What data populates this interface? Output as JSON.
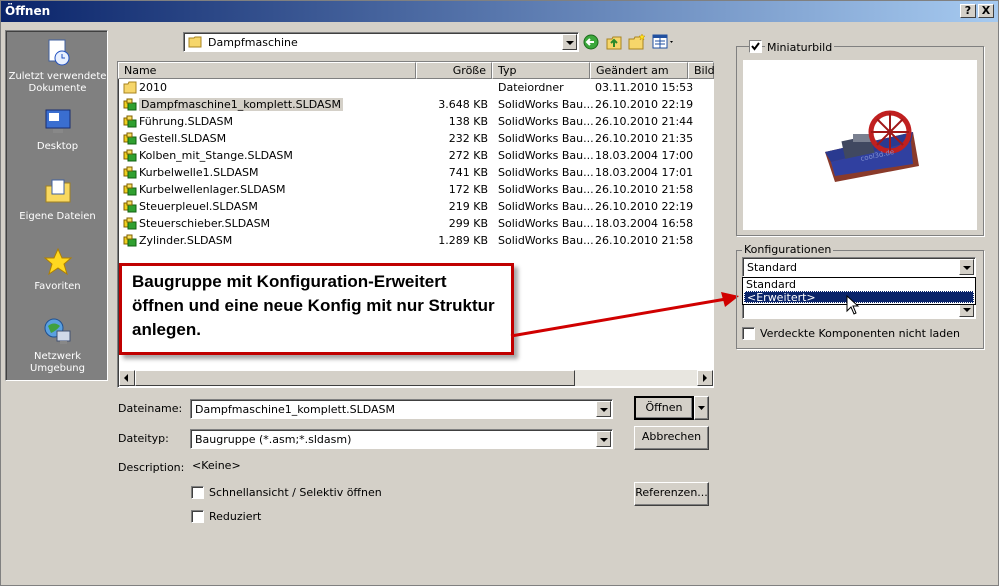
{
  "window": {
    "title": "Öffnen",
    "help_label": "?",
    "close_label": "X"
  },
  "places": [
    {
      "label": "Zuletzt verwendete Dokumente",
      "icon": "recent-docs-icon"
    },
    {
      "label": "Desktop",
      "icon": "desktop-icon"
    },
    {
      "label": "Eigene Dateien",
      "icon": "my-documents-icon"
    },
    {
      "label": "Favoriten",
      "icon": "favorites-star-icon"
    },
    {
      "label": "Netzwerk Umgebung",
      "icon": "network-icon"
    }
  ],
  "location": {
    "value": "Dampfmaschine"
  },
  "columns": {
    "name": "Name",
    "size": "Größe",
    "type": "Typ",
    "modified": "Geändert am",
    "preview": "Bild"
  },
  "files": [
    {
      "name": "2010",
      "size": "",
      "type": "Dateiordner",
      "modified": "03.11.2010 15:53",
      "kind": "folder"
    },
    {
      "name": "Dampfmaschine1_komplett.SLDASM",
      "size": "3.648 KB",
      "type": "SolidWorks Bau...",
      "modified": "26.10.2010 22:19",
      "kind": "assembly"
    },
    {
      "name": "Führung.SLDASM",
      "size": "138 KB",
      "type": "SolidWorks Bau...",
      "modified": "26.10.2010 21:44",
      "kind": "assembly"
    },
    {
      "name": "Gestell.SLDASM",
      "size": "232 KB",
      "type": "SolidWorks Bau...",
      "modified": "26.10.2010 21:35",
      "kind": "assembly"
    },
    {
      "name": "Kolben_mit_Stange.SLDASM",
      "size": "272 KB",
      "type": "SolidWorks Bau...",
      "modified": "18.03.2004 17:00",
      "kind": "assembly"
    },
    {
      "name": "Kurbelwelle1.SLDASM",
      "size": "741 KB",
      "type": "SolidWorks Bau...",
      "modified": "18.03.2004 17:01",
      "kind": "assembly"
    },
    {
      "name": "Kurbelwellenlager.SLDASM",
      "size": "172 KB",
      "type": "SolidWorks Bau...",
      "modified": "26.10.2010 21:58",
      "kind": "assembly"
    },
    {
      "name": "Steuerpleuel.SLDASM",
      "size": "219 KB",
      "type": "SolidWorks Bau...",
      "modified": "26.10.2010 22:19",
      "kind": "assembly"
    },
    {
      "name": "Steuerschieber.SLDASM",
      "size": "299 KB",
      "type": "SolidWorks Bau...",
      "modified": "18.03.2004 16:58",
      "kind": "assembly"
    },
    {
      "name": "Zylinder.SLDASM",
      "size": "1.289 KB",
      "type": "SolidWorks Bau...",
      "modified": "26.10.2010 21:58",
      "kind": "assembly"
    }
  ],
  "selected_file_index": 1,
  "filename": {
    "label": "Dateiname:",
    "value": "Dampfmaschine1_komplett.SLDASM"
  },
  "filetype": {
    "label": "Dateityp:",
    "value": "Baugruppe (*.asm;*.sldasm)"
  },
  "description": {
    "label": "Description:",
    "value": "<Keine>"
  },
  "options": {
    "quickview": {
      "label": "Schnellansicht / Selektiv öffnen",
      "checked": false
    },
    "reduced": {
      "label": "Reduziert",
      "checked": false
    }
  },
  "buttons": {
    "open": "Öffnen",
    "cancel": "Abbrechen",
    "references": "Referenzen..."
  },
  "preview": {
    "label": "Miniaturbild",
    "checked": true,
    "plate_text": "cool3d.de"
  },
  "configurations": {
    "group_label": "Konfigurationen",
    "value": "Standard",
    "options": [
      "Standard",
      "<Erweitert>"
    ],
    "highlighted": "<Erweitert>",
    "hidden_components_label": "Verdeckte Komponenten nicht laden"
  },
  "annotation": {
    "text": "Baugruppe mit Konfiguration-Erweitert öffnen und eine neue Konfig mit nur Struktur anlegen.",
    "color": "#c00000"
  }
}
